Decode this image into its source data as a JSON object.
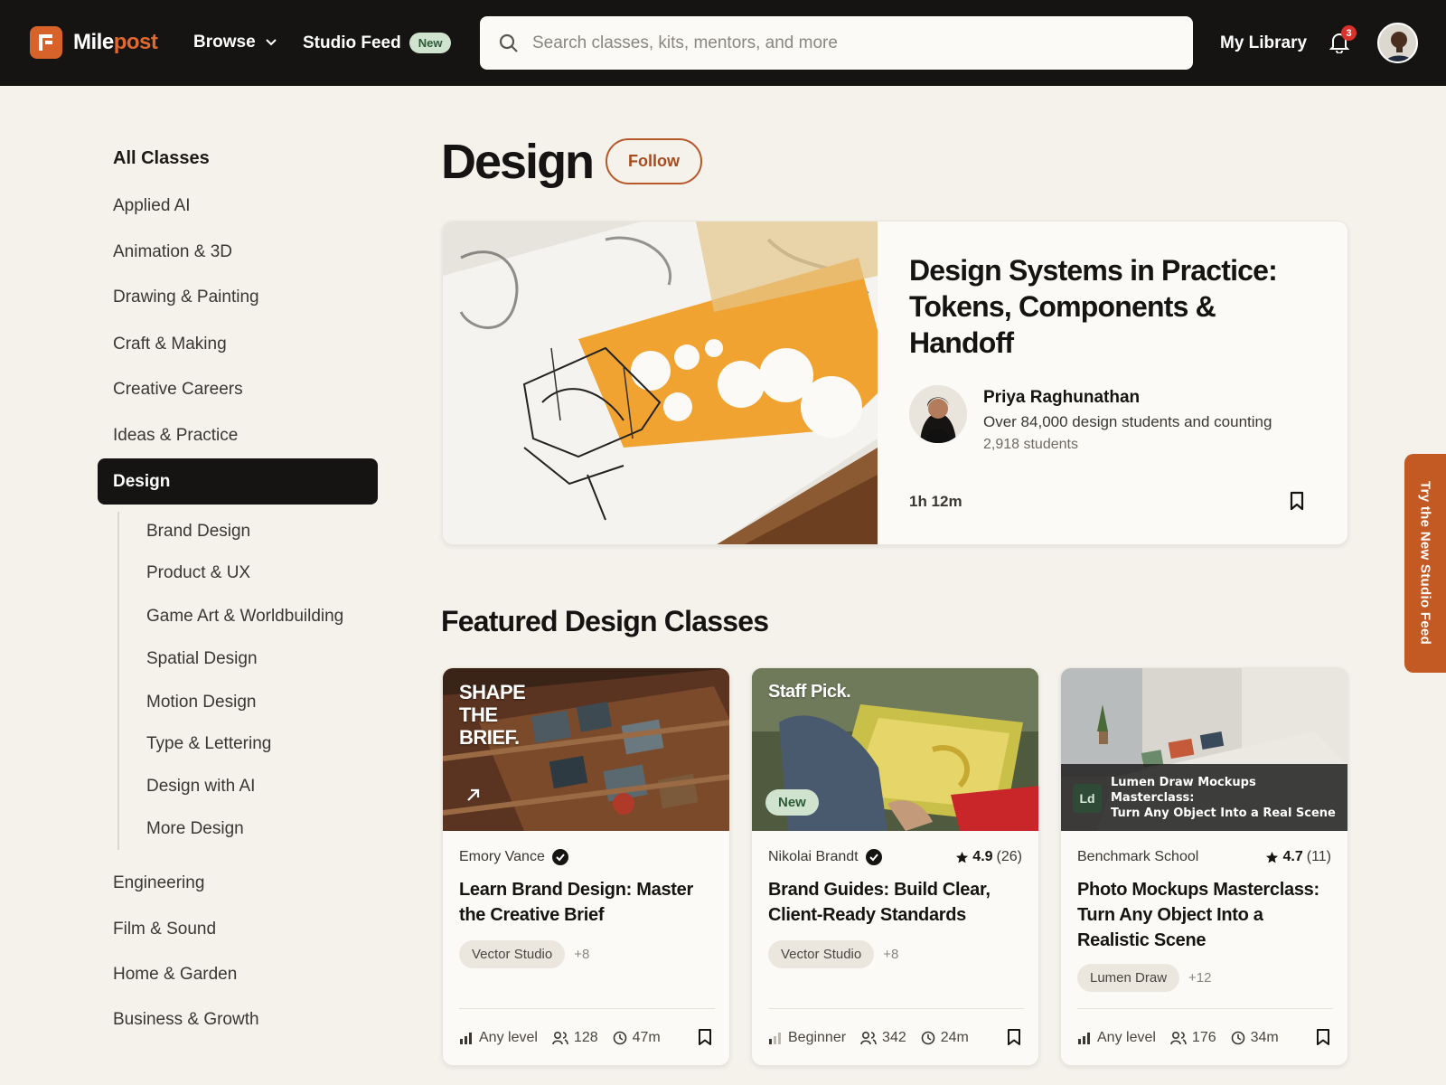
{
  "brand": {
    "name_a": "Mile",
    "name_b": "post",
    "accent": "#d8632a"
  },
  "nav": {
    "browse": "Browse",
    "studio_feed": "Studio Feed",
    "studio_feed_badge": "New",
    "search_placeholder": "Search classes, kits, mentors, and more",
    "my_library": "My Library",
    "notification_count": "3"
  },
  "sidebar": {
    "heading": "All Classes",
    "top_items": [
      {
        "label": "Applied AI"
      },
      {
        "label": "Animation & 3D"
      },
      {
        "label": "Drawing & Painting"
      },
      {
        "label": "Craft & Making"
      },
      {
        "label": "Creative Careers"
      },
      {
        "label": "Ideas & Practice"
      }
    ],
    "active": "Design",
    "sub_items": [
      {
        "label": "Brand Design"
      },
      {
        "label": "Product & UX"
      },
      {
        "label": "Game Art & Worldbuilding"
      },
      {
        "label": "Spatial Design"
      },
      {
        "label": "Motion Design"
      },
      {
        "label": "Type & Lettering"
      },
      {
        "label": "Design with AI"
      },
      {
        "label": "More Design"
      }
    ],
    "bottom_items": [
      {
        "label": "Engineering"
      },
      {
        "label": "Film & Sound"
      },
      {
        "label": "Home & Garden"
      },
      {
        "label": "Business & Growth"
      }
    ]
  },
  "main": {
    "title": "Design",
    "follow": "Follow",
    "hero": {
      "title": "Design Systems in Practice: Tokens, Components & Handoff",
      "author": "Priya Raghunathan",
      "tagline": "Over 84,000 design students and counting",
      "students": "2,918 students",
      "duration": "1h 12m"
    },
    "section_title": "Featured Design Classes",
    "cards": [
      {
        "overlay": "SHAPE THE BRIEF.",
        "author": "Emory Vance",
        "verified": true,
        "title": "Learn Brand Design: Master the Creative Brief",
        "tag": "Vector Studio",
        "tag_more": "+8",
        "level": "Any level",
        "students": "128",
        "duration": "47m"
      },
      {
        "overlay": "Staff Pick.",
        "badge": "New",
        "author": "Nikolai Brandt",
        "verified": true,
        "rating": "4.9",
        "rating_count": "(26)",
        "title": "Brand Guides: Build Clear, Client-Ready Standards",
        "tag": "Vector Studio",
        "tag_more": "+8",
        "level": "Beginner",
        "students": "342",
        "duration": "24m"
      },
      {
        "logo_abbr": "Ld",
        "overlay_line1": "Lumen Draw Mockups",
        "overlay_line2": "Masterclass:",
        "overlay_line3": "Turn Any Object Into a Real Scene",
        "author": "Benchmark School",
        "rating": "4.7",
        "rating_count": "(11)",
        "title": "Photo Mockups Masterclass: Turn Any Object Into a Realistic Scene",
        "tag": "Lumen Draw",
        "tag_more": "+12",
        "level": "Any level",
        "students": "176",
        "duration": "34m"
      }
    ]
  },
  "side_tab": "Try the New Studio Feed"
}
